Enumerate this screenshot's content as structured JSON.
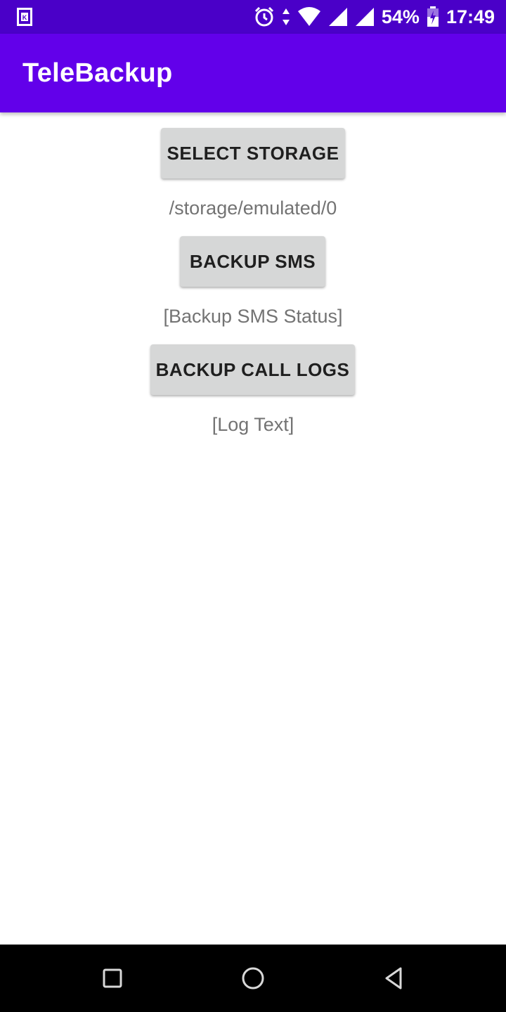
{
  "status_bar": {
    "left_icon": "k-notification-icon",
    "icons": [
      "alarm-icon",
      "data-arrows-icon",
      "wifi-icon",
      "signal-icon",
      "signal-icon",
      "battery-charging-icon"
    ],
    "battery": "54%",
    "time": "17:49"
  },
  "app_bar": {
    "title": "TeleBackup"
  },
  "main": {
    "select_storage_label": "SELECT STORAGE",
    "storage_path": "/storage/emulated/0",
    "backup_sms_label": "BACKUP SMS",
    "backup_sms_status": "[Backup SMS Status]",
    "backup_call_logs_label": "BACKUP CALL LOGS",
    "log_text": "[Log Text]"
  },
  "nav_bar": {
    "buttons": [
      "recents-square-icon",
      "home-circle-icon",
      "back-triangle-icon"
    ]
  },
  "colors": {
    "status_bar": "#4a00c8",
    "app_bar": "#6200ea",
    "button_bg": "#d6d7d7",
    "secondary_text": "#737373"
  }
}
